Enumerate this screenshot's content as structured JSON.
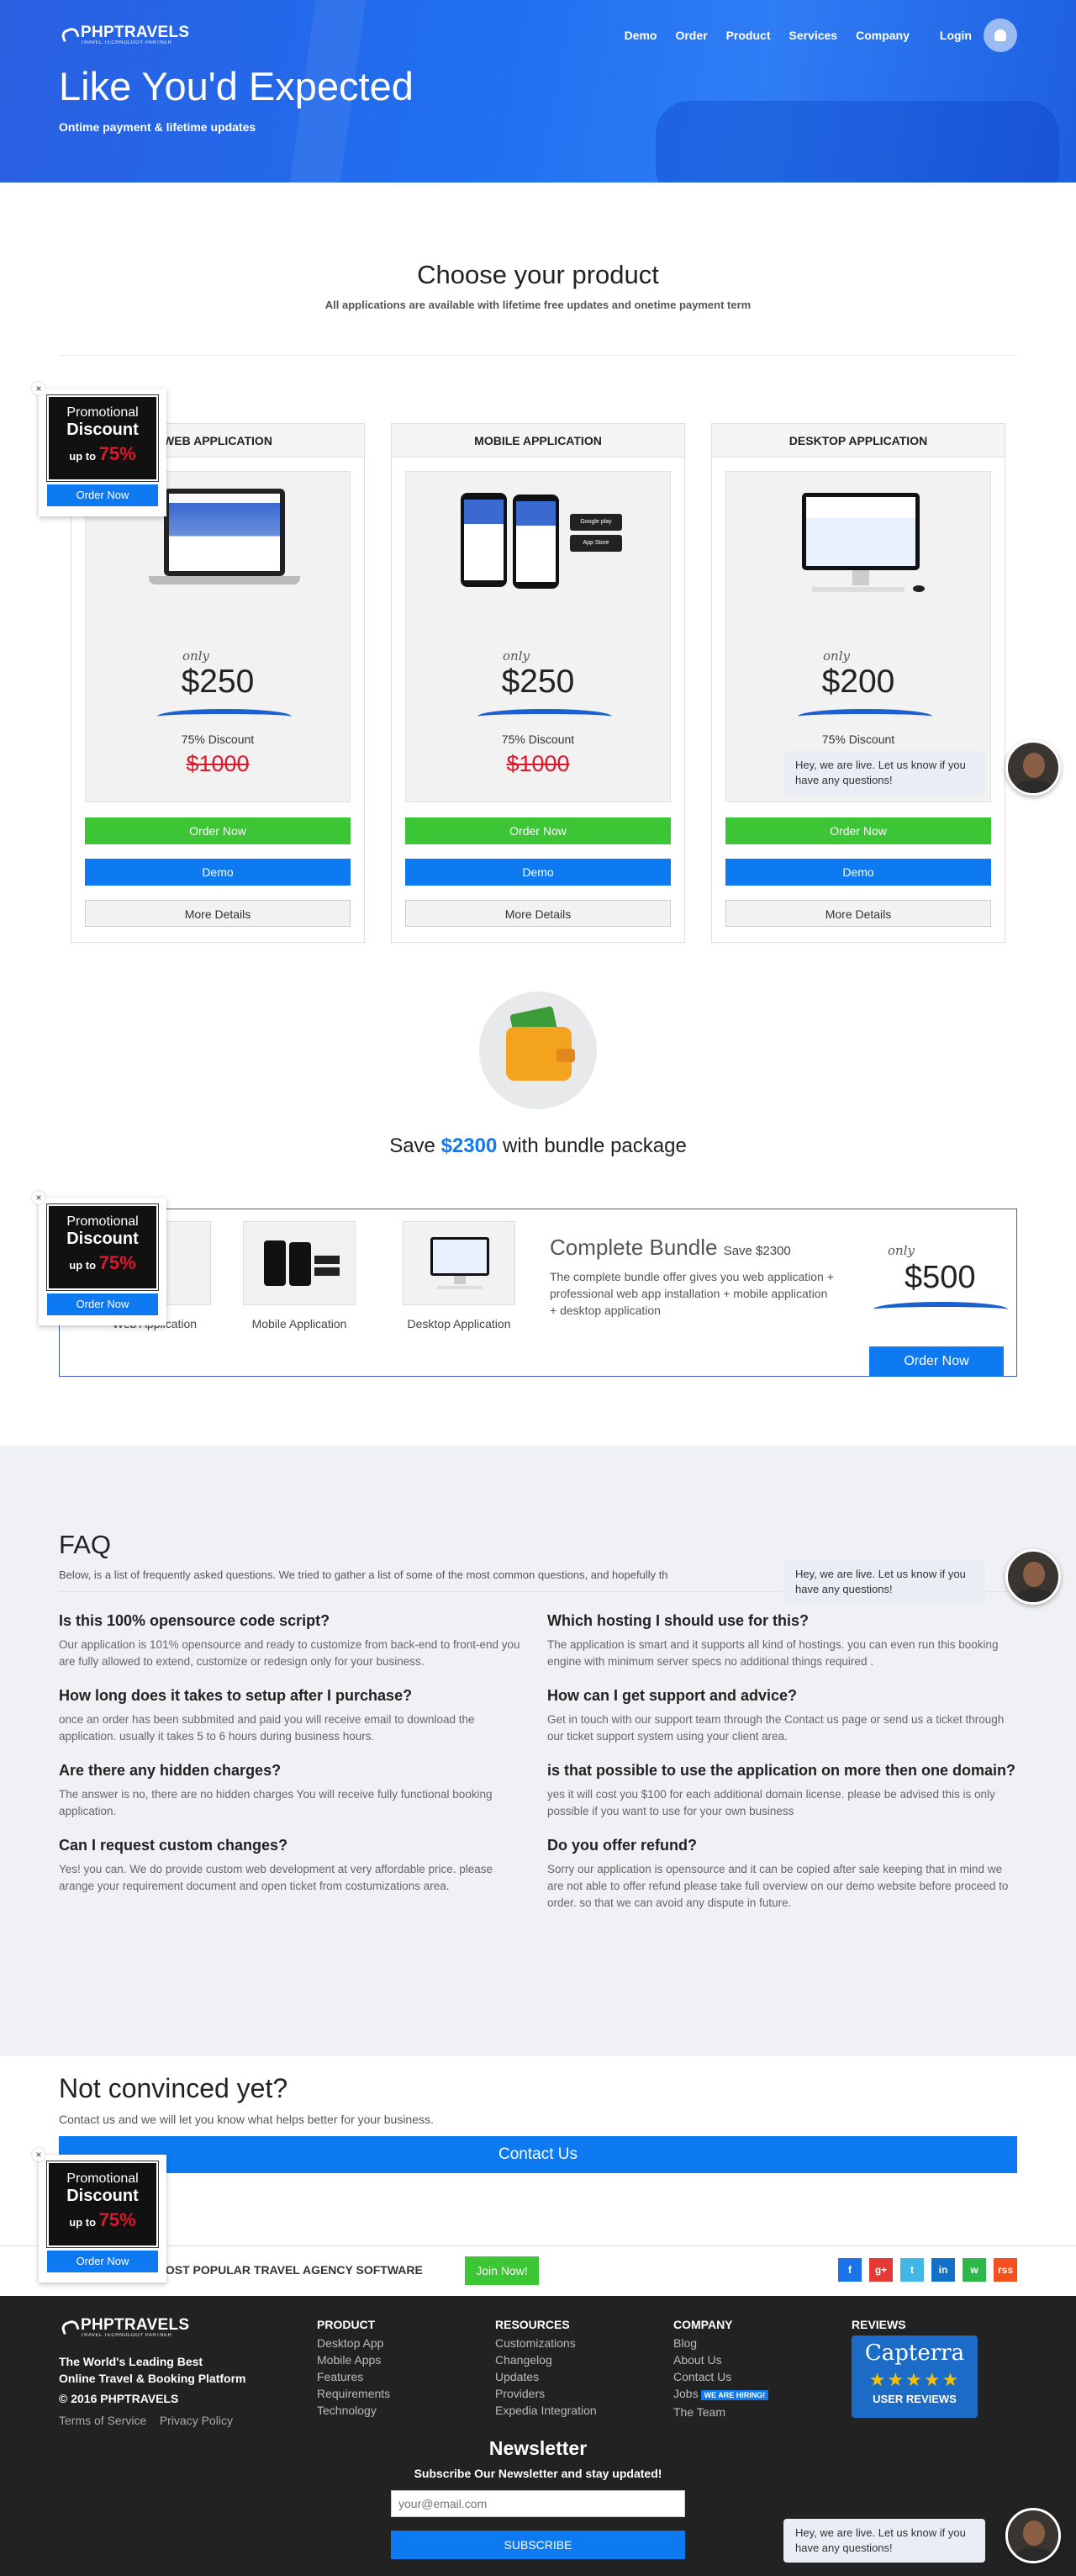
{
  "header": {
    "logo_name": "PHPTRAVELS",
    "logo_tagline": "TRAVEL TECHNOLOGY PARTNER",
    "nav": [
      "Demo",
      "Order",
      "Product",
      "Services",
      "Company"
    ],
    "login": "Login",
    "hero_title": "Like You'd Expected",
    "hero_subtitle": "Ontime payment & lifetime updates"
  },
  "products": {
    "title": "Choose your product",
    "subtitle": "All applications are available with lifetime free updates and onetime payment term",
    "cards": [
      {
        "name": "WEB APPLICATION",
        "only": "only",
        "price": "$250",
        "discount": "75% Discount",
        "old_price": "$1000",
        "order": "Order Now",
        "demo": "Demo",
        "details": "More Details"
      },
      {
        "name": "MOBILE APPLICATION",
        "only": "only",
        "price": "$250",
        "discount": "75% Discount",
        "old_price": "$1000",
        "order": "Order Now",
        "demo": "Demo",
        "details": "More Details"
      },
      {
        "name": "DESKTOP APPLICATION",
        "only": "only",
        "price": "$200",
        "discount": "75% Discount",
        "old_price": "",
        "order": "Order Now",
        "demo": "Demo",
        "details": "More Details"
      }
    ],
    "store_badges": [
      "Google play",
      "App Store"
    ]
  },
  "bundle": {
    "save_prefix": "Save",
    "save_amount": "$2300",
    "save_suffix": "with bundle package",
    "thumbs": [
      "Web Application",
      "Mobile Application",
      "Desktop Application"
    ],
    "title": "Complete Bundle",
    "title_small": "Save $2300",
    "description": "The complete bundle offer gives you web application + professional web app installation + mobile application + desktop application",
    "only": "only",
    "price": "$500",
    "order": "Order Now"
  },
  "faq": {
    "title": "FAQ",
    "intro": "Below, is a list of frequently asked questions. We tried to gather a list of some of the most common questions, and hopefully th",
    "items": [
      {
        "q": "Is this 100% opensource code script?",
        "a": "Our application is 101% opensource and ready to customize from back-end to front-end you are fully allowed to extend, customize or redesign only for your business."
      },
      {
        "q": "Which hosting I should use for this?",
        "a": "The application is smart and it supports all kind of hostings. you can even run this booking engine with minimum server specs no additional things required ."
      },
      {
        "q": "How long does it takes to setup after I purchase?",
        "a": "once an order has been subbmited and paid you will receive email to download the application. usually it takes 5 to 6 hours during business hours."
      },
      {
        "q": "How can I get support and advice?",
        "a": "Get in touch with our support team through the Contact us page or send us a ticket through our ticket support system using your client area."
      },
      {
        "q": "Are there any hidden charges?",
        "a": "The answer is no, there are no hidden charges You will receive fully functional booking application."
      },
      {
        "q": "is that possible to use the application on more then one domain?",
        "a": "yes it will cost you $100 for each additional domain license. please be advised this is only possible if you want to use for your own business"
      },
      {
        "q": "Can I request custom changes?",
        "a": "Yes! you can. We do provide custom web development at very affordable price. please arange your requirement document and open ticket from costumizations area."
      },
      {
        "q": "Do you offer refund?",
        "a": "Sorry our application is opensource and it can be copied after sale keeping that in mind we are not able to offer refund please take full overview on our demo website before proceed to order. so that we can avoid any dispute in future."
      }
    ]
  },
  "not_convinced": {
    "title": "Not convinced yet?",
    "text": "Contact us and we will let you know what helps better for your business.",
    "button": "Contact Us"
  },
  "strip": {
    "text": "LD'S MOST POPULAR TRAVEL AGENCY SOFTWARE",
    "join": "Join Now!",
    "social": [
      "f",
      "g+",
      "t",
      "in",
      "w",
      "rss"
    ]
  },
  "footer": {
    "logo_name": "PHPTRAVELS",
    "logo_tagline": "TRAVEL TECHNOLOGY PARTNER",
    "tag1": "The World's Leading Best",
    "tag2": "Online Travel & Booking Platform",
    "copyright": "© 2016 PHPTRAVELS",
    "terms": "Terms of Service",
    "privacy": "Privacy Policy",
    "product_title": "PRODUCT",
    "product_links": [
      "Desktop App",
      "Mobile Apps",
      "Features",
      "Requirements",
      "Technology"
    ],
    "resources_title": "RESOURCES",
    "resources_links": [
      "Customizations",
      "Changelog",
      "Updates",
      "Providers",
      "Expedia Integration"
    ],
    "company_title": "COMPANY",
    "company_links": [
      "Blog",
      "About Us",
      "Contact Us",
      "Jobs",
      "The Team"
    ],
    "hiring": "WE ARE HIRING!",
    "reviews_title": "REVIEWS",
    "capterra": "Capterra",
    "capterra_stars": "★★★★★",
    "capterra_reviews": "USER REVIEWS",
    "newsletter_title": "Newsletter",
    "newsletter_text": "Subscribe Our Newsletter and stay updated!",
    "email_placeholder": "your@email.com",
    "subscribe": "SUBSCRIBE"
  },
  "promo": {
    "line1": "Promotional",
    "line2": "Discount",
    "line3": "up to",
    "percent": "75%",
    "line4": "Discount",
    "button": "Order Now"
  },
  "chat": {
    "message": "Hey, we are live. Let us know if you have any questions!"
  }
}
